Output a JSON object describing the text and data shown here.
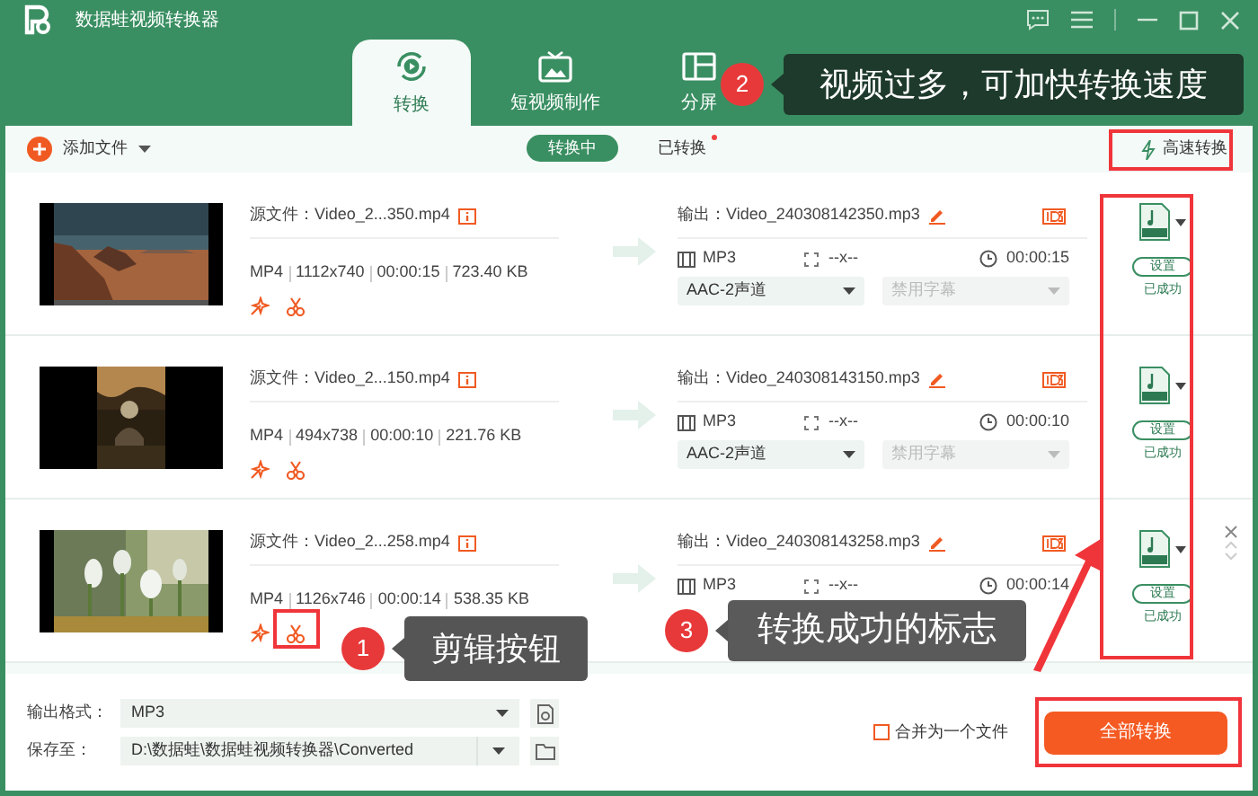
{
  "window": {
    "title": "数据蛙视频转换器"
  },
  "tabs": [
    {
      "label": "转换",
      "selected": true
    },
    {
      "label": "短视频制作",
      "selected": false
    },
    {
      "label": "分屏",
      "selected": false
    }
  ],
  "toolbar": {
    "add_file": "添加文件",
    "subtabs": [
      {
        "label": "转换中",
        "selected": true,
        "dot": false
      },
      {
        "label": "已转换",
        "selected": false,
        "dot": true
      }
    ],
    "speed_button": "高速转换"
  },
  "files": [
    {
      "source": "源文件：Video_2...350.mp4",
      "format": "MP4",
      "resolution": "1112x740",
      "duration": "00:00:15",
      "size": "723.40 KB",
      "output": "输出：Video_240308142350.mp3",
      "out_format": "MP3",
      "out_resolution": "--x--",
      "out_duration": "00:00:15",
      "audio": "AAC-2声道",
      "subtitle": "禁用字幕",
      "settings": "设置",
      "status": "已成功",
      "hovered": false
    },
    {
      "source": "源文件：Video_2...150.mp4",
      "format": "MP4",
      "resolution": "494x738",
      "duration": "00:00:10",
      "size": "221.76 KB",
      "output": "输出：Video_240308143150.mp3",
      "out_format": "MP3",
      "out_resolution": "--x--",
      "out_duration": "00:00:10",
      "audio": "AAC-2声道",
      "subtitle": "禁用字幕",
      "settings": "设置",
      "status": "已成功",
      "hovered": false
    },
    {
      "source": "源文件：Video_2...258.mp4",
      "format": "MP4",
      "resolution": "1126x746",
      "duration": "00:00:14",
      "size": "538.35 KB",
      "output": "输出：Video_240308143258.mp3",
      "out_format": "MP3",
      "out_resolution": "--x--",
      "out_duration": "00:00:14",
      "settings": "设置",
      "status": "已成功",
      "hovered": true
    }
  ],
  "bottom": {
    "format_label": "输出格式：",
    "format": "MP3",
    "save_label": "保存至：",
    "save_path": "D:\\数据蛙\\数据蛙视频转换器\\Converted",
    "merge": {
      "label": "合并为一个文件",
      "checked": false
    },
    "convert_all": "全部转换"
  },
  "annotations": [
    {
      "number": "2",
      "text": "视频过多，可加快转换速度"
    },
    {
      "number": "1",
      "text": "剪辑按钮"
    },
    {
      "number": "3",
      "text": "转换成功的标志"
    }
  ]
}
